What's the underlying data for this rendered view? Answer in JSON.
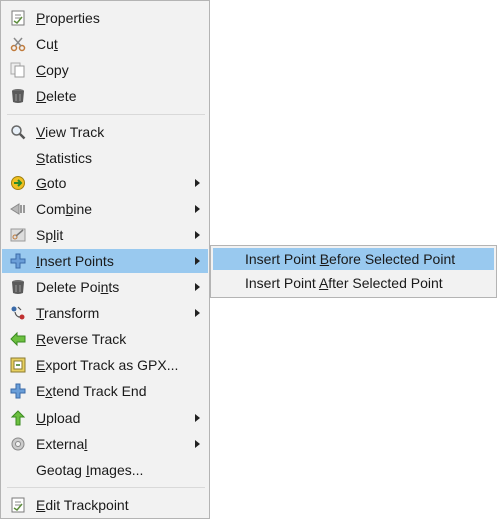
{
  "menu": {
    "items": [
      {
        "key": "properties",
        "pre": "",
        "u": "P",
        "post": "roperties",
        "icon": "properties-icon"
      },
      {
        "key": "cut",
        "pre": "Cu",
        "u": "t",
        "post": "",
        "icon": "scissors-icon"
      },
      {
        "key": "copy",
        "pre": "",
        "u": "C",
        "post": "opy",
        "icon": "copy-icon"
      },
      {
        "key": "delete",
        "pre": "",
        "u": "D",
        "post": "elete",
        "icon": "trash-icon"
      },
      {
        "key": "view-track",
        "pre": "",
        "u": "V",
        "post": "iew Track",
        "icon": "magnifier-icon"
      },
      {
        "key": "statistics",
        "pre": "",
        "u": "S",
        "post": "tatistics",
        "icon": ""
      },
      {
        "key": "goto",
        "pre": "",
        "u": "G",
        "post": "oto",
        "icon": "goto-arrow-icon",
        "submenu": true
      },
      {
        "key": "combine",
        "pre": "Com",
        "u": "b",
        "post": "ine",
        "icon": "combine-icon",
        "submenu": true
      },
      {
        "key": "split",
        "pre": "Sp",
        "u": "l",
        "post": "it",
        "icon": "split-icon",
        "submenu": true
      },
      {
        "key": "insert-points",
        "pre": "",
        "u": "I",
        "post": "nsert Points",
        "icon": "plus-icon",
        "submenu": true,
        "highlighted": true
      },
      {
        "key": "delete-points",
        "pre": "Delete Poi",
        "u": "n",
        "post": "ts",
        "icon": "trash-icon",
        "submenu": true
      },
      {
        "key": "transform",
        "pre": "",
        "u": "T",
        "post": "ransform",
        "icon": "transform-icon",
        "submenu": true
      },
      {
        "key": "reverse-track",
        "pre": "",
        "u": "R",
        "post": "everse Track",
        "icon": "reverse-arrow-icon"
      },
      {
        "key": "export-track",
        "pre": "",
        "u": "E",
        "post": "xport Track as GPX...",
        "icon": "export-icon"
      },
      {
        "key": "extend-track-end",
        "pre": "E",
        "u": "x",
        "post": "tend Track End",
        "icon": "plus-icon"
      },
      {
        "key": "upload",
        "pre": "",
        "u": "U",
        "post": "pload",
        "icon": "upload-arrow-icon",
        "submenu": true
      },
      {
        "key": "external",
        "pre": "Externa",
        "u": "l",
        "post": "",
        "icon": "external-icon",
        "submenu": true
      },
      {
        "key": "geotag-images",
        "pre": "Geotag ",
        "u": "I",
        "post": "mages...",
        "icon": ""
      },
      {
        "key": "edit-trackpoint",
        "pre": "",
        "u": "E",
        "post": "dit Trackpoint",
        "icon": "properties-icon"
      }
    ]
  },
  "submenu": {
    "items": [
      {
        "key": "insert-before",
        "pre": "Insert Point ",
        "u": "B",
        "post": "efore Selected Point",
        "highlighted": true
      },
      {
        "key": "insert-after",
        "pre": "Insert Point ",
        "u": "A",
        "post": "fter Selected Point"
      }
    ]
  },
  "colors": {
    "menu_bg": "#f2f2f2",
    "highlight": "#99c9ef",
    "border": "#b4b4b4"
  }
}
